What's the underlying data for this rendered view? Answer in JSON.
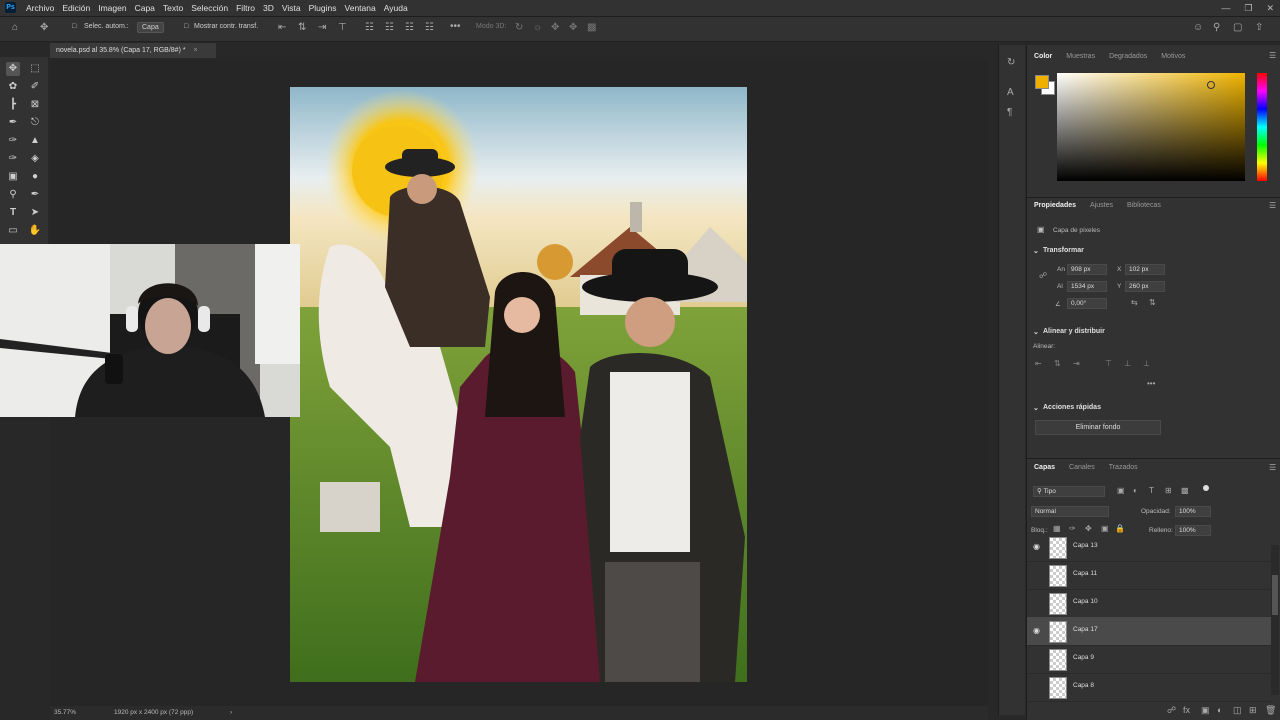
{
  "menu": {
    "logo": "Ps",
    "items": [
      "Archivo",
      "Edición",
      "Imagen",
      "Capa",
      "Texto",
      "Selección",
      "Filtro",
      "3D",
      "Vista",
      "Plugins",
      "Ventana",
      "Ayuda"
    ]
  },
  "options_bar": {
    "auto_select_label": "Selec. autom.:",
    "auto_select_value": "Capa",
    "show_transform_label": "Mostrar contr. transf.",
    "mode3d_label": "Modo 3D:"
  },
  "document": {
    "tab_title": "novela.psd al 35.8% (Capa 17, RGB/8#) *",
    "zoom": "35.77%",
    "doc_info": "1920 px x 2400 px (72 ppp)"
  },
  "color_panel": {
    "tabs": [
      "Color",
      "Muestras",
      "Degradados",
      "Motivos"
    ],
    "foreground": "#f0b000",
    "background": "#ffffff",
    "hue": "#f0b400"
  },
  "properties_panel": {
    "tabs": [
      "Propiedades",
      "Ajustes",
      "Bibliotecas"
    ],
    "layer_type": "Capa de píxeles",
    "transform_title": "Transformar",
    "width_label": "An",
    "width": "908 px",
    "height_label": "Al",
    "height": "1534 px",
    "x_label": "X",
    "x": "102 px",
    "y_label": "Y",
    "y": "260 px",
    "angle": "0,00°",
    "align_title": "Alinear y distribuir",
    "align_label": "Alinear:",
    "quick_actions_title": "Acciones rápidas",
    "remove_bg_button": "Eliminar fondo"
  },
  "layers_panel": {
    "tabs": [
      "Capas",
      "Canales",
      "Trazados"
    ],
    "filter_kind": "Tipo",
    "blend_mode": "Normal",
    "opacity_label": "Opacidad:",
    "opacity": "100%",
    "lock_label": "Bloq.:",
    "fill_label": "Relleno:",
    "fill": "100%",
    "layers": [
      {
        "name": "Capa 13",
        "visible": true,
        "selected": false
      },
      {
        "name": "Capa 11",
        "visible": false,
        "selected": false
      },
      {
        "name": "Capa 10",
        "visible": false,
        "selected": false
      },
      {
        "name": "Capa 17",
        "visible": true,
        "selected": true
      },
      {
        "name": "Capa 9",
        "visible": false,
        "selected": false
      },
      {
        "name": "Capa 8",
        "visible": false,
        "selected": false
      }
    ]
  }
}
